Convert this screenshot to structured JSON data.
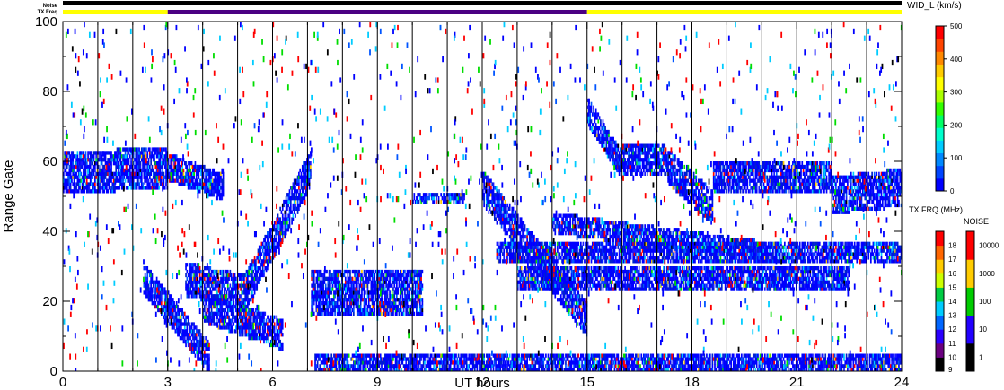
{
  "header": {
    "noise_label": "Noise",
    "txfreq_label": "TX Freq"
  },
  "chart_data": {
    "type": "heatmap",
    "xlabel": "UT hours",
    "ylabel": "Range Gate",
    "xlim": [
      0,
      24
    ],
    "ylim": [
      0,
      100
    ],
    "x_ticks": [
      "0",
      "3",
      "6",
      "9",
      "12",
      "15",
      "18",
      "21",
      "24"
    ],
    "y_ticks": [
      "0",
      "20",
      "40",
      "60",
      "80",
      "100"
    ],
    "grid": "vertical lines every hour",
    "noise_strip": "black",
    "txfreq_strip": [
      {
        "from": 0,
        "to": 3,
        "color": "#ffff00"
      },
      {
        "from": 3,
        "to": 15,
        "color": "#4b0082"
      },
      {
        "from": 15,
        "to": 24,
        "color": "#ffff00"
      }
    ],
    "main_colorbar": {
      "title": "WID_L (km/s)",
      "ticks": [
        "0",
        "100",
        "200",
        "300",
        "400",
        "500"
      ],
      "range": [
        0,
        500
      ],
      "colors": [
        "#0000ff",
        "#0044ff",
        "#0088ff",
        "#00ccff",
        "#00ffcc",
        "#00ff66",
        "#33ff00",
        "#aaff00",
        "#ffff00",
        "#ffcc00",
        "#ff8800",
        "#ff4400",
        "#ff0000"
      ]
    },
    "freq_colorbar": {
      "title": "TX FRQ (MHz)",
      "ticks": [
        "9",
        "10",
        "11",
        "12",
        "13",
        "14",
        "15",
        "16",
        "17",
        "18"
      ],
      "colors": [
        "#000000",
        "#6a0080",
        "#2b00ff",
        "#0066ff",
        "#00ccff",
        "#00cc44",
        "#ccff00",
        "#ffcc00",
        "#ff6600",
        "#ff0000"
      ]
    },
    "noise_colorbar": {
      "title": "NOISE",
      "ticks": [
        "1",
        "10",
        "100",
        "1000",
        "10000"
      ],
      "colors": [
        "#000000",
        "#2200ff",
        "#00cc00",
        "#ffcc00",
        "#ff0000"
      ]
    },
    "echo_colors": [
      "#0000ff",
      "#0022cc",
      "#1a1aff",
      "#0055ff",
      "#00ccff",
      "#ff0000",
      "#00dd00",
      "#ffcc00",
      "#000000"
    ],
    "bands": [
      {
        "x0": 0.0,
        "x1": 3.0,
        "y0": 56,
        "y1": 58,
        "h": 10
      },
      {
        "x0": 3.5,
        "x1": 5.2,
        "y0": 26,
        "y1": 22,
        "h": 8
      },
      {
        "x0": 5.2,
        "x1": 7.1,
        "y0": 22,
        "y1": 58,
        "h": 9
      },
      {
        "x0": 2.3,
        "x1": 4.2,
        "y0": 26,
        "y1": 3,
        "h": 7
      },
      {
        "x0": 4.0,
        "x1": 6.3,
        "y0": 18,
        "y1": 10,
        "h": 7
      },
      {
        "x0": 3.0,
        "x1": 4.6,
        "y0": 58,
        "y1": 52,
        "h": 6
      },
      {
        "x0": 7.1,
        "x1": 10.3,
        "y0": 22,
        "y1": 22,
        "h": 12
      },
      {
        "x0": 12.0,
        "x1": 15.0,
        "y0": 52,
        "y1": 14,
        "h": 8
      },
      {
        "x0": 12.4,
        "x1": 24.0,
        "y0": 34,
        "y1": 33,
        "h": 4
      },
      {
        "x0": 13.0,
        "x1": 22.5,
        "y0": 26,
        "y1": 26,
        "h": 5
      },
      {
        "x0": 14.0,
        "x1": 20.5,
        "y0": 42,
        "y1": 33,
        "h": 4
      },
      {
        "x0": 15.0,
        "x1": 16.0,
        "y0": 74,
        "y1": 58,
        "h": 6
      },
      {
        "x0": 16.0,
        "x1": 17.3,
        "y0": 60,
        "y1": 60,
        "h": 7
      },
      {
        "x0": 17.3,
        "x1": 18.6,
        "y0": 58,
        "y1": 46,
        "h": 8
      },
      {
        "x0": 18.6,
        "x1": 22.0,
        "y0": 55,
        "y1": 55,
        "h": 7
      },
      {
        "x0": 22.0,
        "x1": 24.0,
        "y0": 50,
        "y1": 52,
        "h": 9
      },
      {
        "x0": 10.0,
        "x1": 11.5,
        "y0": 49,
        "y1": 49,
        "h": 2
      },
      {
        "x0": 7.2,
        "x1": 24.0,
        "y0": 2,
        "y1": 2,
        "h": 4
      }
    ]
  }
}
